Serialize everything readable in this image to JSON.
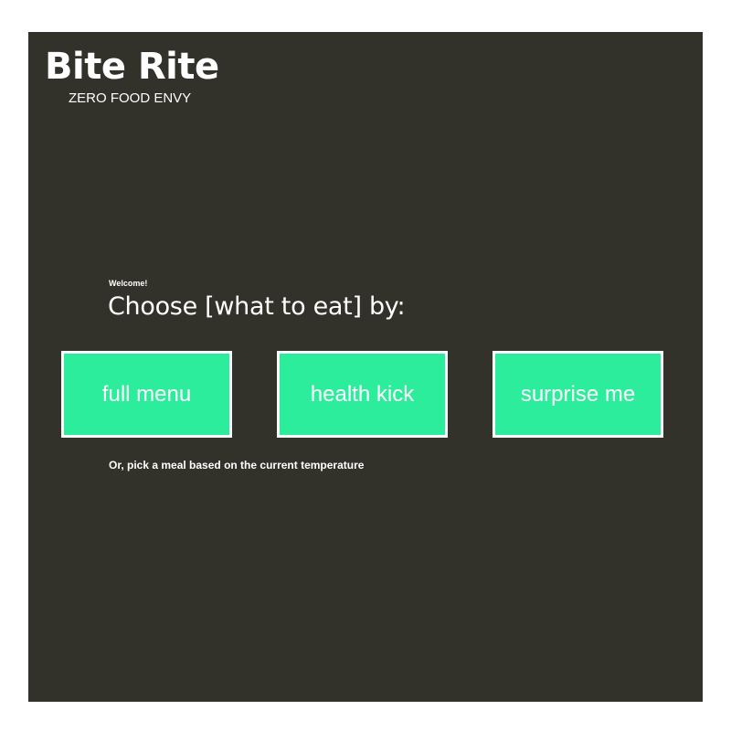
{
  "brand": {
    "title": "Bite Rite",
    "tagline": "ZERO FOOD ENVY"
  },
  "main": {
    "welcome": "Welcome!",
    "heading": "Choose [what to eat] by:",
    "options": [
      {
        "label": "full menu"
      },
      {
        "label": "health kick"
      },
      {
        "label": "surprise me"
      }
    ],
    "temperature_link": "Or, pick a meal based on the current temperature"
  },
  "colors": {
    "background": "#32312a",
    "accent": "#2ced9c",
    "text": "#ffffff"
  }
}
